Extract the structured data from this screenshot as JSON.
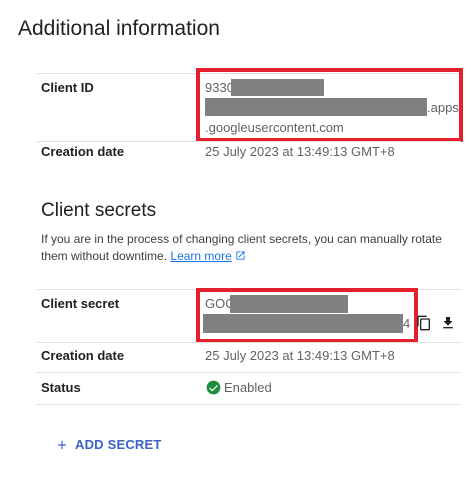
{
  "page_title": "Additional information",
  "client_id": {
    "label": "Client ID",
    "prefix": "9330",
    "suffix": ".apps",
    "line2": ".googleusercontent.com"
  },
  "creation_date_1": {
    "label": "Creation date",
    "value": "25 July 2023 at 13:49:13 GMT+8"
  },
  "client_secrets": {
    "title": "Client secrets",
    "description": "If you are in the process of changing client secrets, you can manually rotate them without downtime.",
    "learn_more": "Learn more"
  },
  "client_secret": {
    "label": "Client secret",
    "prefix": "GOC",
    "suffix": "4",
    "copy_icon": "copy-icon",
    "download_icon": "download-icon"
  },
  "creation_date_2": {
    "label": "Creation date",
    "value": "25 July 2023 at 13:49:13 GMT+8"
  },
  "status": {
    "label": "Status",
    "value": "Enabled",
    "color": "#1e8e3e"
  },
  "add_secret": {
    "label": "ADD SECRET",
    "color": "#3c62c9"
  },
  "colors": {
    "redaction": "#808080",
    "highlight_box": "#e5202e"
  }
}
